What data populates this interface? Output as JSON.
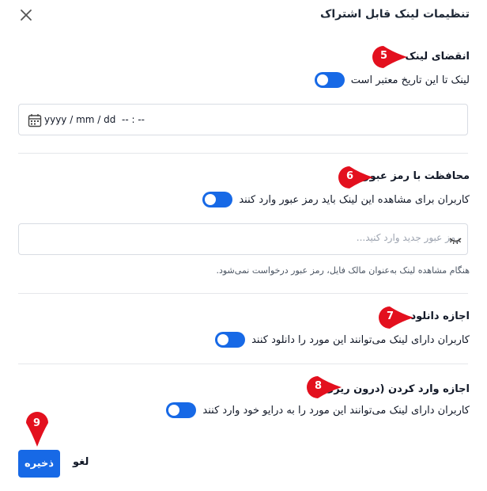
{
  "dialog": {
    "title": "تنظیمات لینک قابل اشتراک",
    "close_icon": "close-icon"
  },
  "expiry": {
    "title": "انقضای لینک",
    "toggle_label": "لینک تا این تاریخ معتبر است",
    "toggle_on": true,
    "date_placeholder": "yyyy / mm / dd  -- : --",
    "calendar_icon": "calendar-icon"
  },
  "password": {
    "title": "محافظت با رمز عبور",
    "toggle_label": "کاربران برای مشاهده این لینک باید رمز عبور وارد کنند",
    "toggle_on": true,
    "input_placeholder": "رمز عبور جدید وارد کنید...",
    "eye_icon": "eye-icon",
    "hint": "هنگام مشاهده لینک به‌عنوان مالک فایل، رمز عبور درخواست نمی‌شود."
  },
  "download": {
    "title": "اجازه دانلود",
    "toggle_label": "کاربران دارای لینک می‌توانند این مورد را دانلود کنند",
    "toggle_on": true
  },
  "import": {
    "title": "اجازه وارد کردن (درون ریزی)",
    "toggle_label": "کاربران دارای لینک می‌توانند این مورد را به درایو خود وارد کنند",
    "toggle_on": true
  },
  "footer": {
    "save_label": "ذخیره",
    "cancel_label": "لغو"
  },
  "annotations": {
    "badge_5": "5",
    "badge_6": "6",
    "badge_7": "7",
    "badge_8": "8",
    "badge_9": "9"
  },
  "colors": {
    "accent": "#1769e6",
    "badge": "#e3101e"
  }
}
